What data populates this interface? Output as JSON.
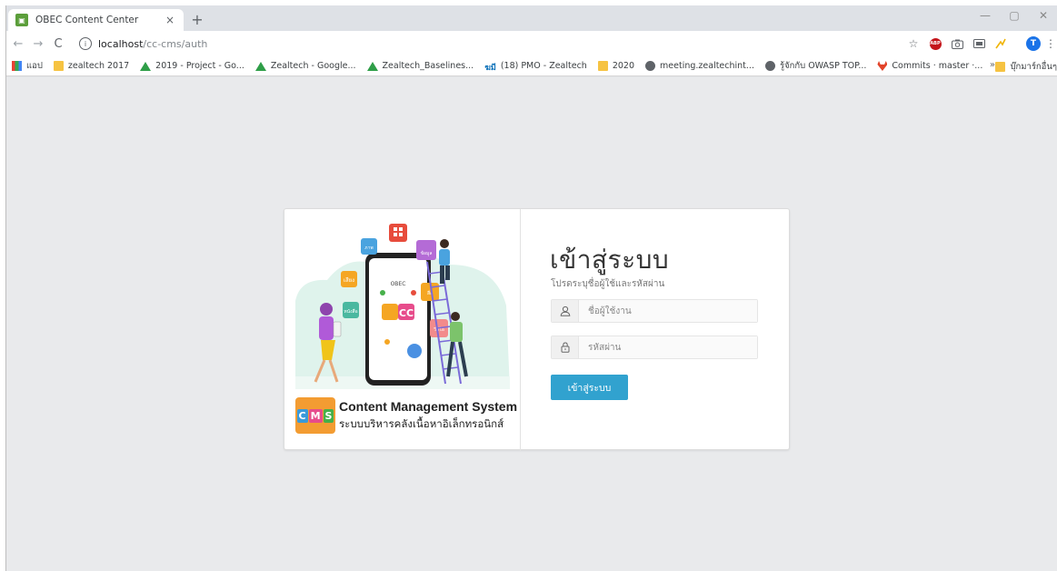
{
  "browser": {
    "tab": {
      "title": "OBEC Content Center",
      "close": "×"
    },
    "new_tab": "+",
    "window_controls": {
      "minimize": "—",
      "maximize": "▢",
      "close": "✕"
    },
    "nav": {
      "back": "←",
      "forward": "→",
      "reload": "C"
    },
    "address": {
      "host": "localhost",
      "path": "/cc-cms/auth",
      "info": "i"
    },
    "toolbar_icons": [
      "star-icon",
      "adblock-icon",
      "camera-icon",
      "cast-icon",
      "extension-icon",
      "profile-icon",
      "menu-icon"
    ],
    "profile_initial": "T",
    "star": "☆",
    "menu": "⋮",
    "bookmarks": [
      {
        "label": "แอป",
        "icon": "apps"
      },
      {
        "label": "zealtech 2017",
        "icon": "folder"
      },
      {
        "label": "2019 - Project - Go...",
        "icon": "drive"
      },
      {
        "label": "Zealtech - Google...",
        "icon": "drive"
      },
      {
        "label": "Zealtech_Baselines...",
        "icon": "drive"
      },
      {
        "label": "(18) PMO - Zealtech",
        "icon": "thai",
        "prefix": "ฆมี"
      },
      {
        "label": "2020",
        "icon": "folder"
      },
      {
        "label": "meeting.zealtechint...",
        "icon": "globe"
      },
      {
        "label": "รู้จักกับ OWASP TOP...",
        "icon": "globe"
      },
      {
        "label": "Commits · master ·...",
        "icon": "gitlab"
      }
    ],
    "bookmarks_more": "»",
    "bookmarks_right": "บุ๊กมาร์กอื่นๆ"
  },
  "brand": {
    "title": "Content Management System",
    "subtitle": "ระบบบริหารคลังเนื้อหาอิเล็กทรอนิกส์",
    "logo_letters": [
      "C",
      "M",
      "S"
    ]
  },
  "illustration": {
    "labels": {
      "phone_top": "OBEC",
      "cc": "CC",
      "app1": "ภาพ",
      "app2": "สื่อ",
      "app3": "ข้อมูล",
      "app4": "วีดีโอ",
      "app5": "หนังสือ",
      "app6": "เสียง"
    }
  },
  "login": {
    "title": "เข้าสู่ระบบ",
    "subtitle": "โปรดระบุชื่อผู้ใช้และรหัสผ่าน",
    "username": {
      "placeholder": "ชื่อผู้ใช้งาน",
      "value": ""
    },
    "password": {
      "placeholder": "รหัสผ่าน",
      "value": ""
    },
    "submit_label": "เข้าสู่ระบบ"
  }
}
